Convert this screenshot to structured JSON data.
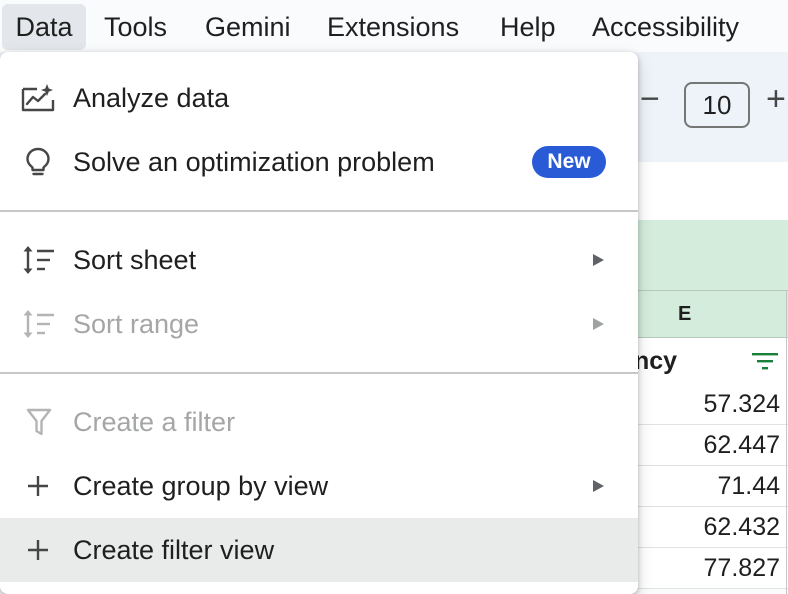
{
  "menubar": {
    "items": [
      {
        "label": "Data",
        "active": true
      },
      {
        "label": "Tools"
      },
      {
        "label": "Gemini"
      },
      {
        "label": "Extensions"
      },
      {
        "label": "Help"
      },
      {
        "label": "Accessibility"
      }
    ]
  },
  "toolbar": {
    "font_size": "10",
    "decrease_symbol": "−",
    "increase_symbol": "+"
  },
  "sheet": {
    "column_letter": "E",
    "header_text": "ncy",
    "values": [
      "57.324",
      "62.447",
      "71.44",
      "62.432",
      "77.827"
    ],
    "accent_color": "#188038"
  },
  "menu": {
    "items": [
      {
        "label": "Analyze data",
        "icon": "analyze-data-icon"
      },
      {
        "label": "Solve an optimization problem",
        "icon": "lightbulb-icon",
        "badge": "New"
      },
      {
        "label": "Sort sheet",
        "icon": "sort-icon",
        "submenu": true
      },
      {
        "label": "Sort range",
        "icon": "sort-icon",
        "submenu": true,
        "disabled": true
      },
      {
        "label": "Create a filter",
        "icon": "filter-icon",
        "disabled": true
      },
      {
        "label": "Create group by view",
        "icon": "plus-icon",
        "submenu": true
      },
      {
        "label": "Create filter view",
        "icon": "plus-icon",
        "highlighted": true
      }
    ],
    "badge_color": "#2a5bd7"
  }
}
